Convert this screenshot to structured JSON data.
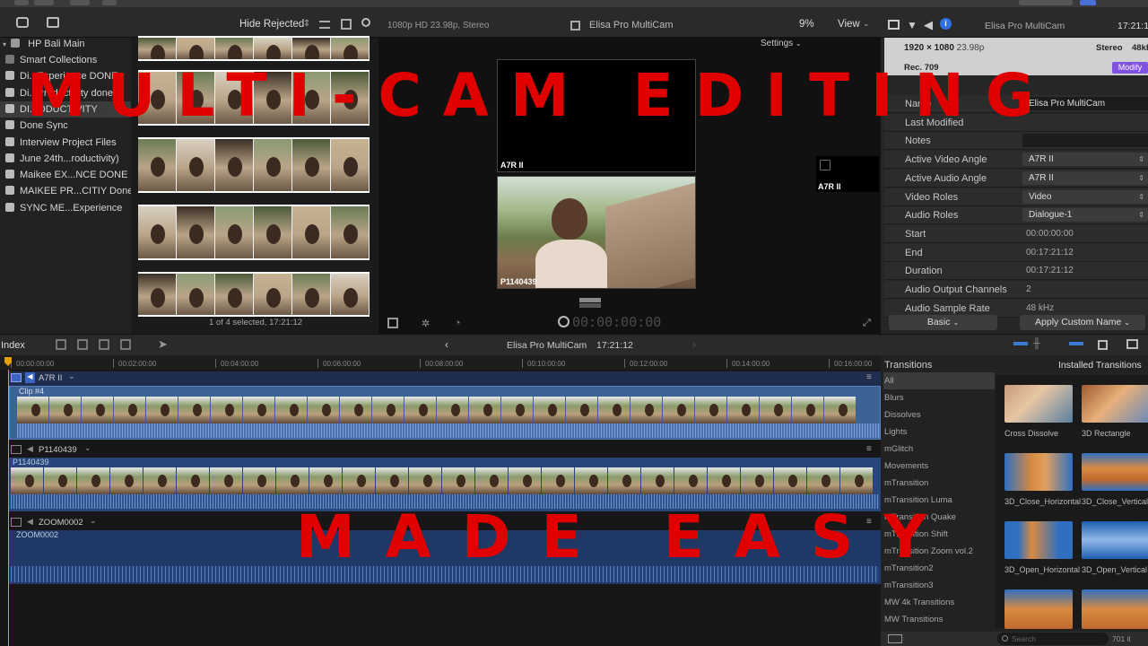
{
  "toolbar": {
    "hide_rejected": "Hide Rejected",
    "viewer_format": "1080p HD 23.98p, Stereo",
    "viewer_title": "Elisa Pro MultiCam",
    "zoom": "9%",
    "view": "View",
    "inspector_title": "Elisa Pro MultiCam",
    "inspector_time": "17:21:1"
  },
  "sidebar": {
    "library": "HP Bali Main",
    "items": [
      {
        "label": "Smart Collections"
      },
      {
        "label": "Di...Experience DONE"
      },
      {
        "label": "Di...Productivity done"
      },
      {
        "label": "DI...ODUCTIVITY"
      },
      {
        "label": "Done Sync"
      },
      {
        "label": "Interview Project Files"
      },
      {
        "label": "June 24th...roductivity)"
      },
      {
        "label": "Maikee EX...NCE DONE"
      },
      {
        "label": "MAIKEE PR...CITIY Done"
      },
      {
        "label": "SYNC ME...Experience"
      }
    ]
  },
  "browser": {
    "status": "1 of 4 selected, 17:21:12"
  },
  "viewer": {
    "settings": "Settings",
    "angle1": "A7R II",
    "angle2": "P1140439",
    "side_angle": "A7R II",
    "timecode": "00:00:00:00"
  },
  "inspector": {
    "resolution": "1920 × 1080",
    "fps": "23.98p",
    "audio": "Stereo",
    "audio_rate": "48kH",
    "color": "Rec. 709",
    "modify": "Modify",
    "rows": [
      {
        "label": "Name",
        "value": "Elisa Pro MultiCam",
        "kind": "field"
      },
      {
        "label": "Last Modified",
        "value": "",
        "kind": "text"
      },
      {
        "label": "Notes",
        "value": "",
        "kind": "field"
      },
      {
        "label": "Active Video Angle",
        "value": "A7R II",
        "kind": "pop"
      },
      {
        "label": "Active Audio Angle",
        "value": "A7R II",
        "kind": "pop"
      },
      {
        "label": "Video Roles",
        "value": "Video",
        "kind": "pop"
      },
      {
        "label": "Audio Roles",
        "value": "Dialogue-1",
        "kind": "pop"
      },
      {
        "label": "Start",
        "value": "00:00:00:00",
        "kind": "text"
      },
      {
        "label": "End",
        "value": "00:17:21:12",
        "kind": "text"
      },
      {
        "label": "Duration",
        "value": "00:17:21:12",
        "kind": "text"
      },
      {
        "label": "Audio Output Channels",
        "value": "2",
        "kind": "text"
      },
      {
        "label": "Audio Sample Rate",
        "value": "48 kHz",
        "kind": "text"
      }
    ],
    "basic": "Basic",
    "apply_custom_name": "Apply Custom Name"
  },
  "timeline": {
    "index": "Index",
    "title": "Elisa Pro MultiCam",
    "duration": "17:21:12",
    "ruler": [
      "00:00:00:00",
      "00:02:00:00",
      "00:04:00:00",
      "00:06:00:00",
      "00:08:00:00",
      "00:10:00:00",
      "00:12:00:00",
      "00:14:00:00",
      "00:16:00:00"
    ],
    "angles": [
      {
        "name": "A7R II",
        "clip": "Clip #4"
      },
      {
        "name": "P1140439",
        "clip": "P1140439"
      },
      {
        "name": "ZOOM0002",
        "clip": "ZOOM0002"
      }
    ]
  },
  "transitions": {
    "title": "Transitions",
    "installed": "Installed Transitions",
    "categories": [
      "All",
      "Blurs",
      "Dissolves",
      "Lights",
      "mGlitch",
      "Movements",
      "mTransition",
      "mTransition Luma",
      "mTransition Quake",
      "mTransition Shift",
      "mTransition Zoom vol.2",
      "mTransition2",
      "mTransition3",
      "MW 4k Transitions",
      "MW Transitions"
    ],
    "items": [
      {
        "label": "Cross Dissolve"
      },
      {
        "label": "3D Rectangle"
      },
      {
        "label": "3D_Close_Horizontal"
      },
      {
        "label": "3D_Close_Vertical"
      },
      {
        "label": "3D_Open_Horizontal"
      },
      {
        "label": "3D_Open_Vertical"
      }
    ],
    "count": "701 it",
    "search_placeholder": "Search"
  },
  "overlay": {
    "line1": "MULTI-CAM EDITING",
    "line2": "MADE EASY",
    "color": "#e10000"
  }
}
